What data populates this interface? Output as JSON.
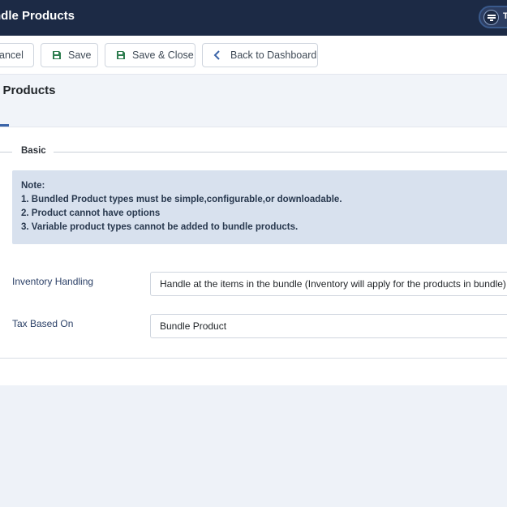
{
  "header": {
    "title": "ndle Products",
    "user_initial": "T"
  },
  "toolbar": {
    "cancel_label": "ancel",
    "save_label": "Save",
    "save_close_label": "Save & Close",
    "back_label": "Back to Dashboard"
  },
  "page": {
    "title": "e Products"
  },
  "fieldset": {
    "legend": "Basic"
  },
  "note": {
    "lines": [
      "Note:",
      "1. Bundled Product types must be simple,configurable,or downloadable.",
      "2. Product cannot have options",
      "3. Variable product types cannot be added to bundle products."
    ]
  },
  "fields": {
    "inventory_handling": {
      "label": "Inventory Handling",
      "value": "Handle at the items in the bundle (Inventory will apply for the products in bundle)"
    },
    "tax_based_on": {
      "label": "Tax Based On",
      "value": "Bundle Product"
    }
  },
  "colors": {
    "header_bg": "#1c2a45",
    "accent": "#3a64a8",
    "save_icon": "#2e7d4f",
    "note_bg": "#d8e1ee"
  },
  "icons": {
    "save": "floppy-disk-icon",
    "back": "chevron-left-icon",
    "user": "user-menu-icon"
  }
}
